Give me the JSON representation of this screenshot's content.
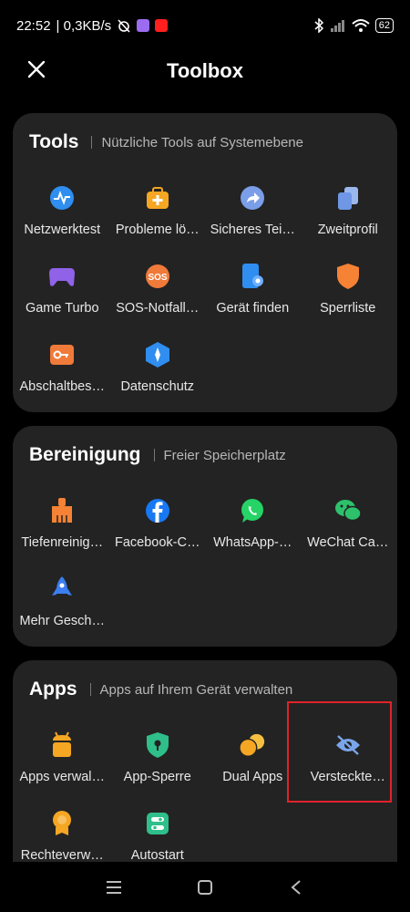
{
  "status": {
    "time": "22:52",
    "network_speed": "| 0,3KB/s",
    "battery": "62"
  },
  "header": {
    "title": "Toolbox"
  },
  "sections": [
    {
      "title": "Tools",
      "subtitle": "Nützliche Tools auf Systemebene",
      "items": [
        {
          "label": "Netzwerktest",
          "icon": "network-test-icon",
          "color": "#2f8ef0"
        },
        {
          "label": "Probleme lö…",
          "icon": "troubleshoot-icon",
          "color": "#f5a623"
        },
        {
          "label": "Sicheres Tei…",
          "icon": "secure-share-icon",
          "color": "#7a9ee8"
        },
        {
          "label": "Zweitprofil",
          "icon": "second-profile-icon",
          "color": "#7aa5ea"
        },
        {
          "label": "Game Turbo",
          "icon": "gamepad-icon",
          "color": "#8f62e8"
        },
        {
          "label": "SOS-Notfall…",
          "icon": "sos-icon",
          "color": "#f07a3a"
        },
        {
          "label": "Gerät finden",
          "icon": "find-device-icon",
          "color": "#2f8ef0"
        },
        {
          "label": "Sperrliste",
          "icon": "shield-icon",
          "color": "#f58235"
        },
        {
          "label": "Abschaltbes…",
          "icon": "key-icon",
          "color": "#f07a3a"
        },
        {
          "label": "Datenschutz",
          "icon": "privacy-icon",
          "color": "#2f8ef0"
        }
      ]
    },
    {
      "title": "Bereinigung",
      "subtitle": "Freier Speicherplatz",
      "items": [
        {
          "label": "Tiefenreinig…",
          "icon": "broom-icon",
          "color": "#f58235"
        },
        {
          "label": "Facebook-C…",
          "icon": "facebook-icon",
          "color": "#1877f2"
        },
        {
          "label": "WhatsApp-…",
          "icon": "whatsapp-icon",
          "color": "#25d366"
        },
        {
          "label": "WeChat Ca…",
          "icon": "wechat-icon",
          "color": "#2dc16b"
        },
        {
          "label": "Mehr Gesch…",
          "icon": "rocket-icon",
          "color": "#3b7ef0"
        }
      ]
    },
    {
      "title": "Apps",
      "subtitle": "Apps auf Ihrem Gerät verwalten",
      "items": [
        {
          "label": "Apps verwal…",
          "icon": "android-icon",
          "color": "#f5a623"
        },
        {
          "label": "App-Sperre",
          "icon": "app-lock-icon",
          "color": "#2fbf8a"
        },
        {
          "label": "Dual Apps",
          "icon": "dual-apps-icon",
          "color": "#f5a623"
        },
        {
          "label": "Versteckte…",
          "icon": "eye-hidden-icon",
          "color": "#7aa5ea"
        },
        {
          "label": "Rechteverw…",
          "icon": "permissions-icon",
          "color": "#f5a623"
        },
        {
          "label": "Autostart",
          "icon": "autostart-icon",
          "color": "#2fbf8a"
        }
      ]
    }
  ]
}
